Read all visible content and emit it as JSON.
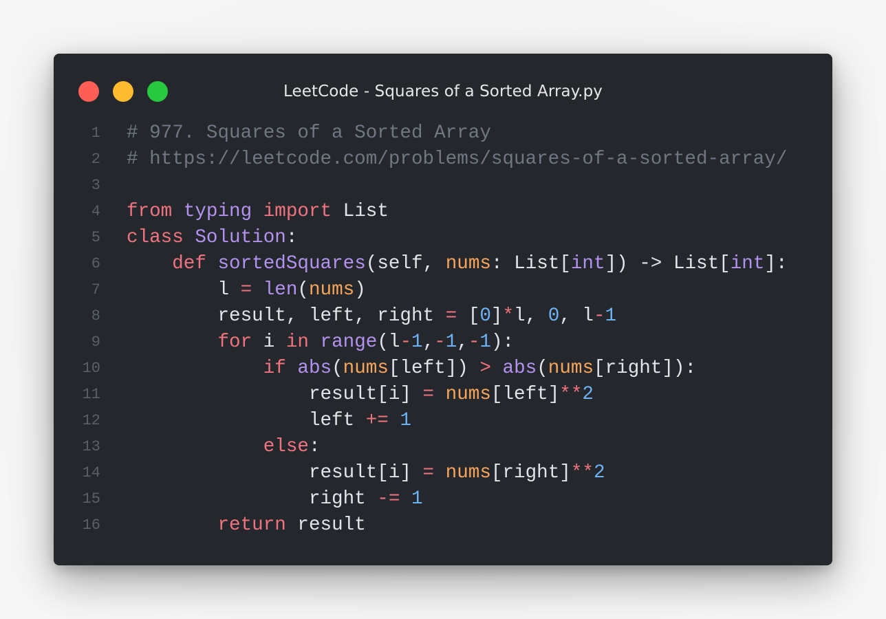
{
  "window": {
    "title": "LeetCode - Squares of a Sorted Array.py",
    "traffic_lights": [
      {
        "name": "close",
        "color": "#ff5f57"
      },
      {
        "name": "minimize",
        "color": "#febc2e"
      },
      {
        "name": "zoom",
        "color": "#28c840"
      }
    ]
  },
  "code": {
    "language": "python",
    "lines": [
      {
        "num": "1",
        "tokens": [
          [
            "comment",
            "# 977. Squares of a Sorted Array"
          ]
        ]
      },
      {
        "num": "2",
        "tokens": [
          [
            "comment",
            "# https://leetcode.com/problems/squares-of-a-sorted-array/"
          ]
        ]
      },
      {
        "num": "3",
        "tokens": []
      },
      {
        "num": "4",
        "tokens": [
          [
            "kw",
            "from"
          ],
          [
            "plain",
            " "
          ],
          [
            "mod",
            "typing"
          ],
          [
            "plain",
            " "
          ],
          [
            "kw",
            "import"
          ],
          [
            "plain",
            " List"
          ]
        ]
      },
      {
        "num": "5",
        "tokens": [
          [
            "kw",
            "class"
          ],
          [
            "plain",
            " "
          ],
          [
            "cls",
            "Solution"
          ],
          [
            "plain",
            ":"
          ]
        ]
      },
      {
        "num": "6",
        "tokens": [
          [
            "plain",
            "    "
          ],
          [
            "kw",
            "def"
          ],
          [
            "plain",
            " "
          ],
          [
            "fn",
            "sortedSquares"
          ],
          [
            "plain",
            "(self, "
          ],
          [
            "param",
            "nums"
          ],
          [
            "plain",
            ": List["
          ],
          [
            "builtin",
            "int"
          ],
          [
            "plain",
            "]) -> List["
          ],
          [
            "builtin",
            "int"
          ],
          [
            "plain",
            "]:"
          ]
        ]
      },
      {
        "num": "7",
        "tokens": [
          [
            "plain",
            "        l "
          ],
          [
            "op",
            "="
          ],
          [
            "plain",
            " "
          ],
          [
            "builtin",
            "len"
          ],
          [
            "plain",
            "("
          ],
          [
            "var",
            "nums"
          ],
          [
            "plain",
            ")"
          ]
        ]
      },
      {
        "num": "8",
        "tokens": [
          [
            "plain",
            "        result, left, right "
          ],
          [
            "op",
            "="
          ],
          [
            "plain",
            " ["
          ],
          [
            "num",
            "0"
          ],
          [
            "plain",
            "]"
          ],
          [
            "op",
            "*"
          ],
          [
            "plain",
            "l, "
          ],
          [
            "num",
            "0"
          ],
          [
            "plain",
            ", l"
          ],
          [
            "op",
            "-"
          ],
          [
            "num",
            "1"
          ]
        ]
      },
      {
        "num": "9",
        "tokens": [
          [
            "plain",
            "        "
          ],
          [
            "kw",
            "for"
          ],
          [
            "plain",
            " i "
          ],
          [
            "kw",
            "in"
          ],
          [
            "plain",
            " "
          ],
          [
            "builtin",
            "range"
          ],
          [
            "plain",
            "(l"
          ],
          [
            "op",
            "-"
          ],
          [
            "num",
            "1"
          ],
          [
            "plain",
            ","
          ],
          [
            "op",
            "-"
          ],
          [
            "num",
            "1"
          ],
          [
            "plain",
            ","
          ],
          [
            "op",
            "-"
          ],
          [
            "num",
            "1"
          ],
          [
            "plain",
            "):"
          ]
        ]
      },
      {
        "num": "10",
        "tokens": [
          [
            "plain",
            "            "
          ],
          [
            "kw",
            "if"
          ],
          [
            "plain",
            " "
          ],
          [
            "builtin",
            "abs"
          ],
          [
            "plain",
            "("
          ],
          [
            "var",
            "nums"
          ],
          [
            "plain",
            "[left]) "
          ],
          [
            "op",
            ">"
          ],
          [
            "plain",
            " "
          ],
          [
            "builtin",
            "abs"
          ],
          [
            "plain",
            "("
          ],
          [
            "var",
            "nums"
          ],
          [
            "plain",
            "[right]):"
          ]
        ]
      },
      {
        "num": "11",
        "tokens": [
          [
            "plain",
            "                result[i] "
          ],
          [
            "op",
            "="
          ],
          [
            "plain",
            " "
          ],
          [
            "var",
            "nums"
          ],
          [
            "plain",
            "[left]"
          ],
          [
            "op",
            "**"
          ],
          [
            "num",
            "2"
          ]
        ]
      },
      {
        "num": "12",
        "tokens": [
          [
            "plain",
            "                left "
          ],
          [
            "op",
            "+="
          ],
          [
            "plain",
            " "
          ],
          [
            "num",
            "1"
          ]
        ]
      },
      {
        "num": "13",
        "tokens": [
          [
            "plain",
            "            "
          ],
          [
            "kw",
            "else"
          ],
          [
            "plain",
            ":"
          ]
        ]
      },
      {
        "num": "14",
        "tokens": [
          [
            "plain",
            "                result[i] "
          ],
          [
            "op",
            "="
          ],
          [
            "plain",
            " "
          ],
          [
            "var",
            "nums"
          ],
          [
            "plain",
            "[right]"
          ],
          [
            "op",
            "**"
          ],
          [
            "num",
            "2"
          ]
        ]
      },
      {
        "num": "15",
        "tokens": [
          [
            "plain",
            "                right "
          ],
          [
            "op",
            "-="
          ],
          [
            "plain",
            " "
          ],
          [
            "num",
            "1"
          ]
        ]
      },
      {
        "num": "16",
        "tokens": [
          [
            "plain",
            "        "
          ],
          [
            "kw",
            "return"
          ],
          [
            "plain",
            " result"
          ]
        ]
      }
    ]
  }
}
